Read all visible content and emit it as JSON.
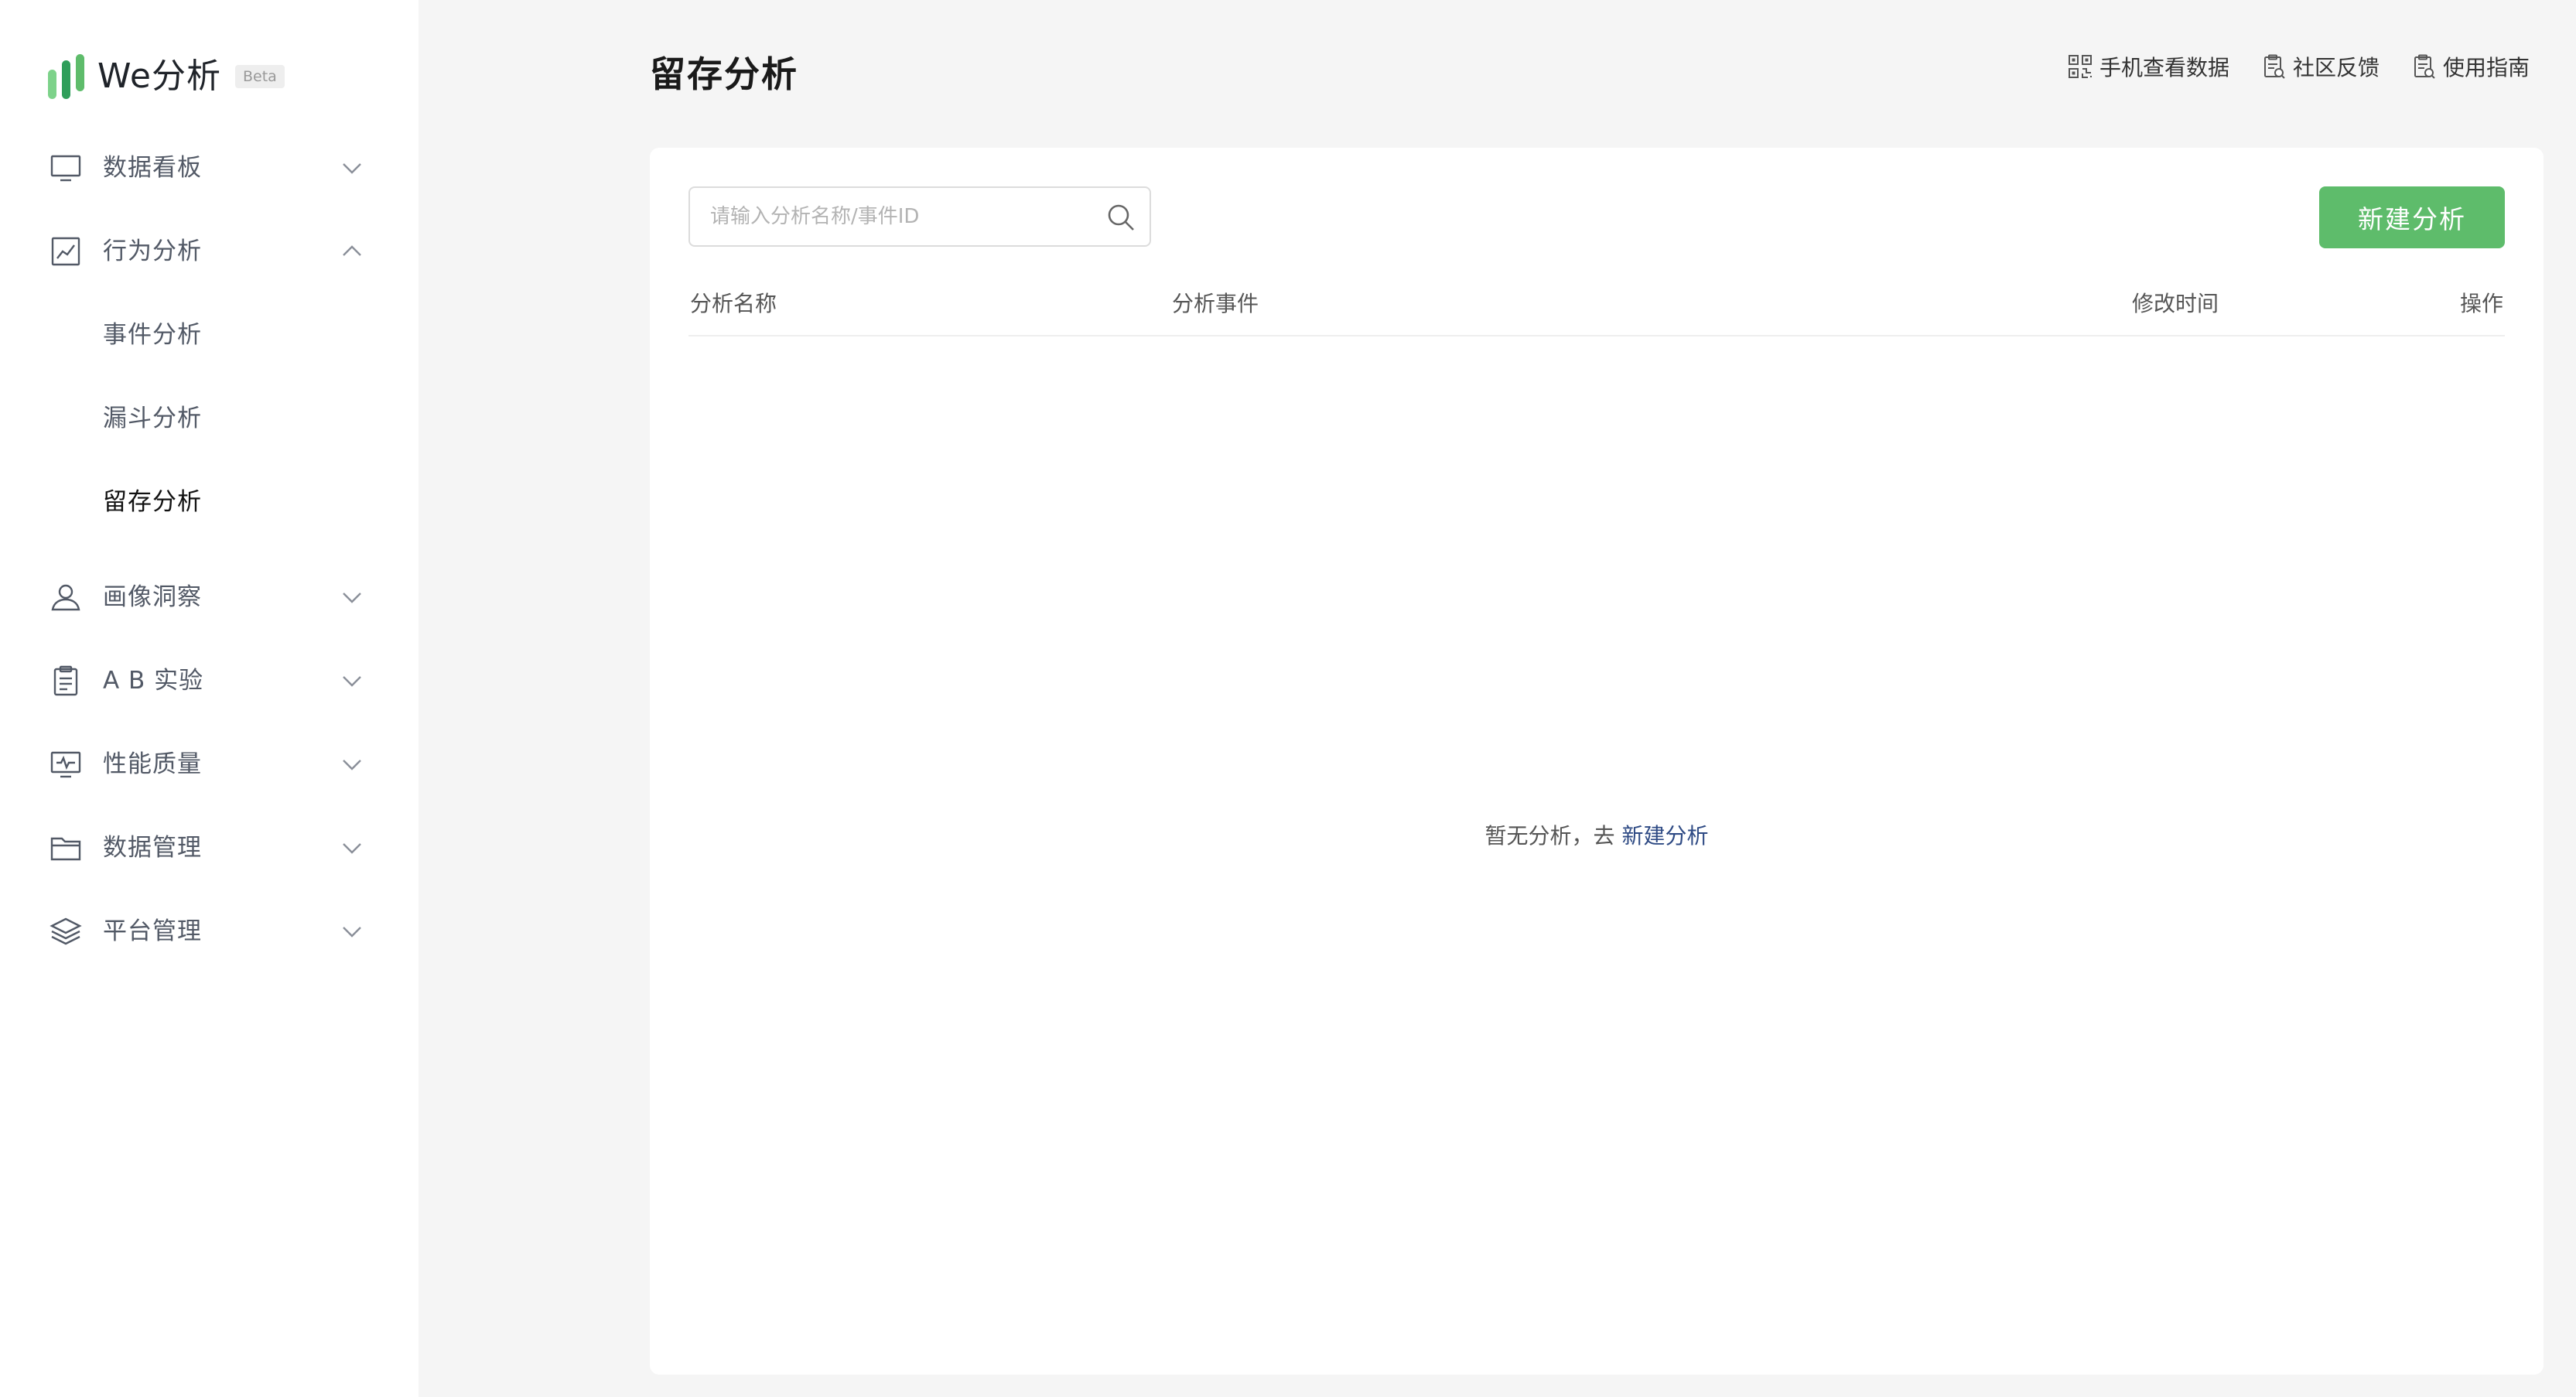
{
  "sidebar": {
    "logo_text": "We分析",
    "beta_label": "Beta",
    "items": [
      {
        "label": "数据看板"
      },
      {
        "label": "行为分析"
      },
      {
        "label": "事件分析"
      },
      {
        "label": "漏斗分析"
      },
      {
        "label": "留存分析"
      },
      {
        "label": "画像洞察"
      },
      {
        "label": "A B 实验"
      },
      {
        "label": "性能质量"
      },
      {
        "label": "数据管理"
      },
      {
        "label": "平台管理"
      }
    ]
  },
  "header": {
    "title": "留存分析",
    "links": [
      {
        "label": "手机查看数据",
        "icon": "qr-code-icon"
      },
      {
        "label": "社区反馈",
        "icon": "feedback-icon"
      },
      {
        "label": "使用指南",
        "icon": "guide-icon"
      }
    ]
  },
  "main": {
    "search": {
      "placeholder": "请输入分析名称/事件ID",
      "value": ""
    },
    "new_button_label": "新建分析",
    "table": {
      "columns": [
        "分析名称",
        "分析事件",
        "修改时间",
        "操作"
      ],
      "rows": []
    },
    "empty": {
      "text": "暂无分析，去 ",
      "link": "新建分析"
    }
  },
  "colors": {
    "accent": "#5ebc6b",
    "link": "#2e4a84",
    "logo_dark": "#2f9e5a",
    "logo_light": "#7dd28a"
  }
}
